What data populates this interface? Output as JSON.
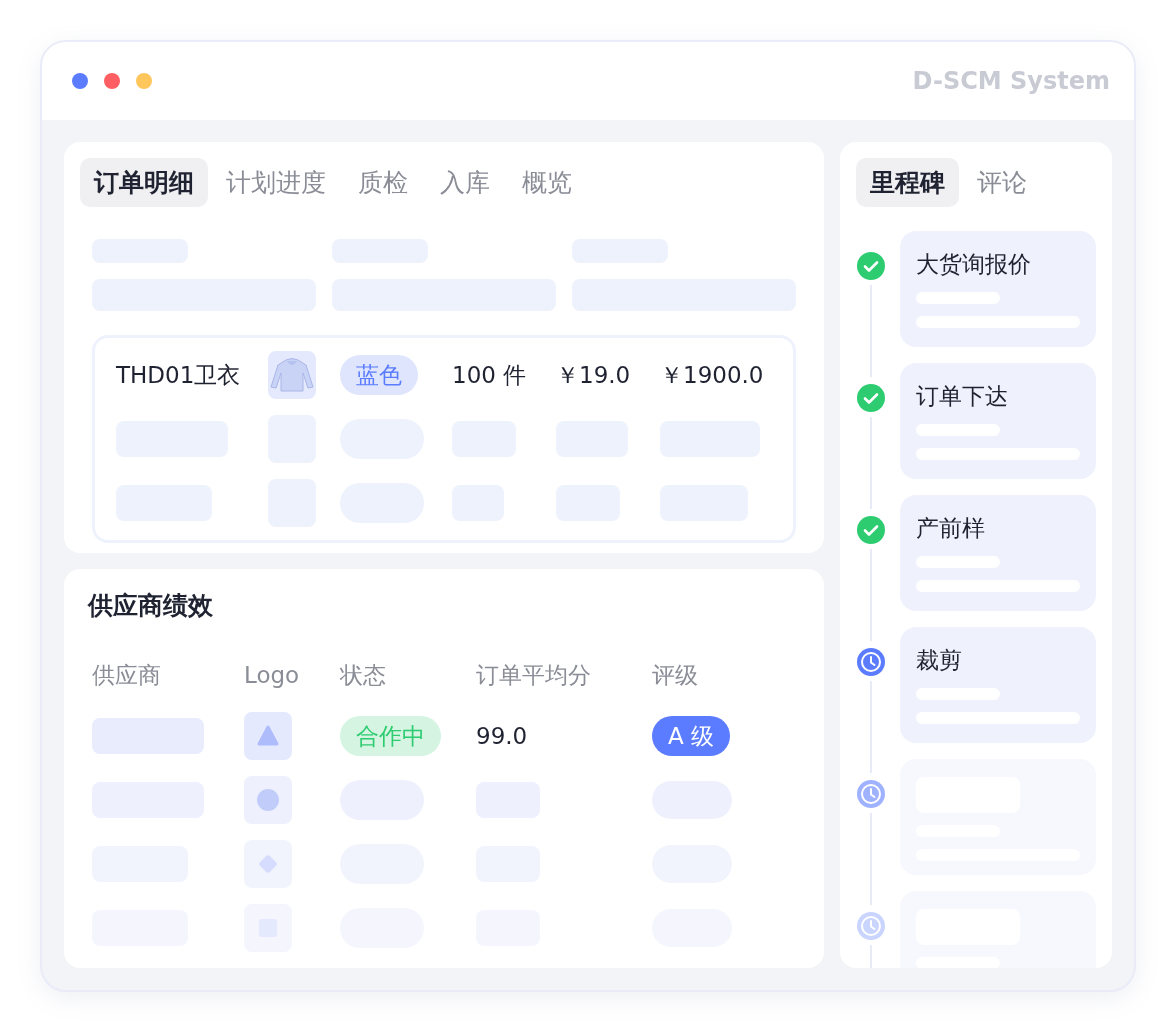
{
  "window": {
    "title": "D-SCM System"
  },
  "order_tabs": [
    {
      "label": "订单明细",
      "selected": true
    },
    {
      "label": "计划进度",
      "selected": false
    },
    {
      "label": "质检",
      "selected": false
    },
    {
      "label": "入库",
      "selected": false
    },
    {
      "label": "概览",
      "selected": false
    }
  ],
  "order_row": {
    "product": "THD01卫衣",
    "color_tag": "蓝色",
    "quantity": "100 件",
    "unit_price": "￥19.0",
    "total": "￥1900.0"
  },
  "supplier_panel": {
    "title": "供应商绩效",
    "columns": [
      "供应商",
      "Logo",
      "状态",
      "订单平均分",
      "评级"
    ],
    "rows": [
      {
        "kind": "triangle",
        "status": "合作中",
        "score": "99.0",
        "grade": "A 级"
      },
      {
        "kind": "circle"
      },
      {
        "kind": "diamond"
      },
      {
        "kind": "square"
      }
    ]
  },
  "side_tabs": [
    {
      "label": "里程碑",
      "selected": true
    },
    {
      "label": "评论",
      "selected": false
    }
  ],
  "milestones": [
    {
      "title": "大货询报价",
      "kind": "done"
    },
    {
      "title": "订单下达",
      "kind": "done"
    },
    {
      "title": "产前样",
      "kind": "done"
    },
    {
      "title": "裁剪",
      "kind": "active"
    },
    {
      "kind": "pending"
    },
    {
      "kind": "pending"
    }
  ]
}
